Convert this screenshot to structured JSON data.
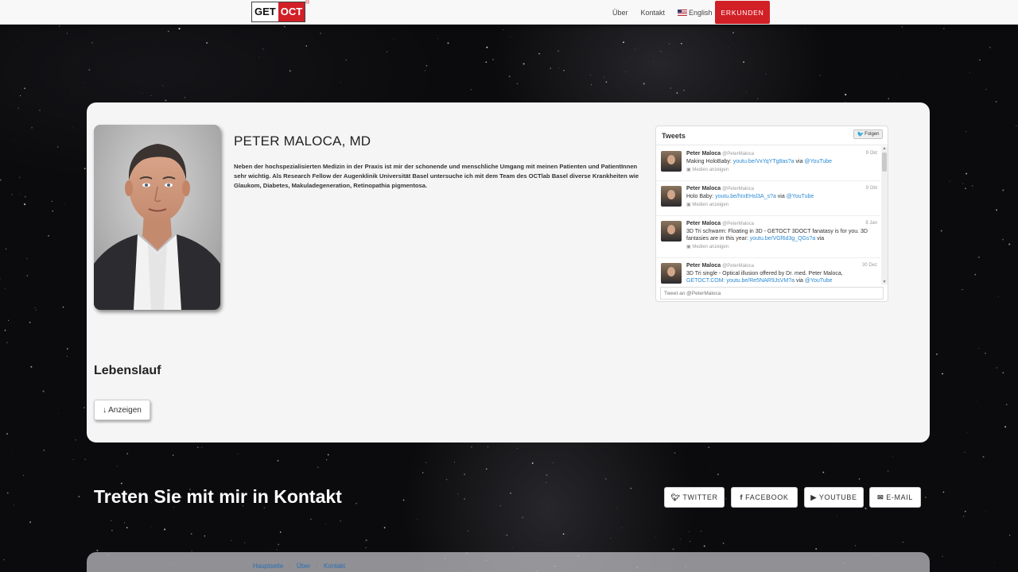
{
  "nav": {
    "logo_get": "GET",
    "logo_oct": "OCT",
    "logo_reg": "®",
    "links": [
      "Über",
      "Kontakt"
    ],
    "language": "English",
    "cta": "ERKUNDEN"
  },
  "profile": {
    "name": "PETER MALOCA, MD",
    "bio": "Neben der hochspezialisierten Medizin in der Praxis ist mir der schonende und menschliche Umgang mit meinen Patienten und PatientInnen sehr wichtig. Als Research Fellow der Augenklinik Universität Basel untersuche ich mit dem Team des OCTlab Basel diverse Krankheiten wie Glaukom, Diabetes, Makuladegeneration, Retinopathia pigmentosa.",
    "cv_heading": "Lebenslauf",
    "cv_button": "Anzeigen"
  },
  "twitter": {
    "title": "Tweets",
    "follow": "Folgen",
    "input_placeholder": "Tweet an @PeterMaloca",
    "tweets": [
      {
        "name": "Peter Maloca",
        "handle": "@PeterMaloca",
        "date": "9 Okt",
        "text_pre": "Making HoloBaby: ",
        "link": "youtu.be/VxYqYTg8as?a",
        "text_mid": " via ",
        "link2": "@YouTube",
        "text_post": "",
        "media": "Medien anzeigen"
      },
      {
        "name": "Peter Maloca",
        "handle": "@PeterMaloca",
        "date": "9 Okt",
        "text_pre": "Holo Baby: ",
        "link": "youtu.be/hIxEHsl3A_s?a",
        "text_mid": " via ",
        "link2": "@YouTube",
        "text_post": "",
        "media": "Medien anzeigen"
      },
      {
        "name": "Peter Maloca",
        "handle": "@PeterMaloca",
        "date": "8 Jan",
        "text_pre": "3D Tri schwarm: Floating in 3D - GETOCT 3DOCT fanatasy is for you. 3D fantasies are in this year: ",
        "link": "youtu.be/VGf6d3g_QGs?a",
        "text_mid": " via",
        "link2": "",
        "text_post": "",
        "media": "Medien anzeigen"
      },
      {
        "name": "Peter Maloca",
        "handle": "@PeterMaloca",
        "date": "30 Dez",
        "text_pre": "3D Tri single - Optical illusion offered by Dr. med. Peter Maloca, ",
        "link": "GETOCT.COM: youtu.be/Re5NAR9JsVM?a",
        "text_mid": " via ",
        "link2": "@YouTube",
        "text_post": "",
        "media": ""
      }
    ]
  },
  "contact": {
    "title": "Treten Sie mit mir in Kontakt",
    "buttons": [
      "TWITTER",
      "FACEBOOK",
      "YOUTUBE",
      "E-MAIL"
    ]
  },
  "footer": {
    "links": [
      "Hauptseite",
      "Über",
      "Kontakt"
    ],
    "separator": "·"
  }
}
